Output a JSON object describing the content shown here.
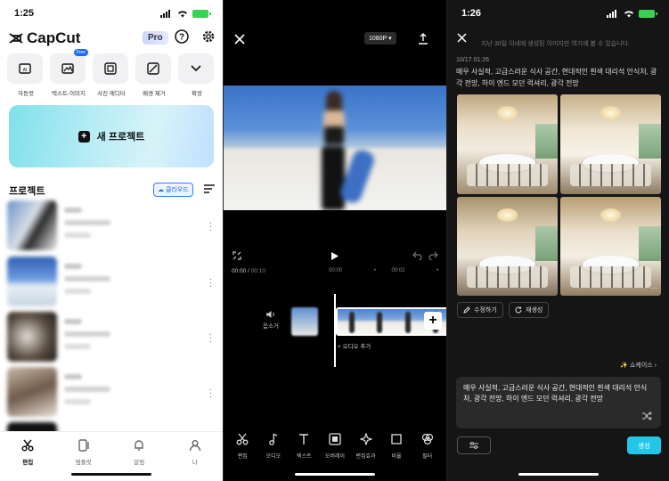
{
  "panel1": {
    "status_time": "1:25",
    "app_name": "CapCut",
    "pro_label": "Pro",
    "tools": [
      {
        "label": "자동컷",
        "icon": "auto-cut-icon"
      },
      {
        "label": "텍스트-이미지",
        "icon": "text-to-image-icon",
        "badge": "Free"
      },
      {
        "label": "사진 에디터",
        "icon": "photo-editor-icon"
      },
      {
        "label": "배경 제거",
        "icon": "remove-bg-icon"
      },
      {
        "label": "확장",
        "icon": "expand-icon"
      }
    ],
    "new_project": "새 프로젝트",
    "projects_title": "프로젝트",
    "cloud_label": "클라우드",
    "tabs": [
      {
        "label": "편집",
        "icon": "scissors-icon"
      },
      {
        "label": "템플릿",
        "icon": "template-icon"
      },
      {
        "label": "알림",
        "icon": "bell-icon"
      },
      {
        "label": "나",
        "icon": "person-icon"
      }
    ]
  },
  "panel2": {
    "resolution": "1080P",
    "timecode_current": "00:00",
    "timecode_total": "00:10",
    "time_marks": [
      "00:00",
      "00:02"
    ],
    "volume_label": "음소거",
    "add_audio": "+ 오디오 추가",
    "toolbar": [
      {
        "label": "편집",
        "icon": "scissors-icon"
      },
      {
        "label": "오디오",
        "icon": "music-icon"
      },
      {
        "label": "텍스트",
        "icon": "text-icon"
      },
      {
        "label": "오버레이",
        "icon": "overlay-icon"
      },
      {
        "label": "편집효과",
        "icon": "effects-icon"
      },
      {
        "label": "비율",
        "icon": "ratio-icon"
      },
      {
        "label": "필터",
        "icon": "filter-icon"
      }
    ]
  },
  "panel3": {
    "status_time": "1:26",
    "notice": "지난 30일 이내에 생성된 이미지만 여기에 볼 수 있습니다.",
    "date": "10/17 01:26",
    "prompt": "매우 사실적, 고급스러운 식사 공간, 현대적인 흰색 대리석 안식처, 광각 전망, 하이 엔드 모던 럭셔리, 광각 전망",
    "edit_button": "수정하기",
    "regen_button": "재생성",
    "showcase": "쇼케이스",
    "input_text": "매우 사실적, 고급스러운 식사 공간, 현대적인 흰색 대리석 안식처, 광각 전망, 하이 엔드 모던 럭셔리, 광각 전망",
    "generate_button": "생성",
    "accent_color": "#24c6e8"
  }
}
